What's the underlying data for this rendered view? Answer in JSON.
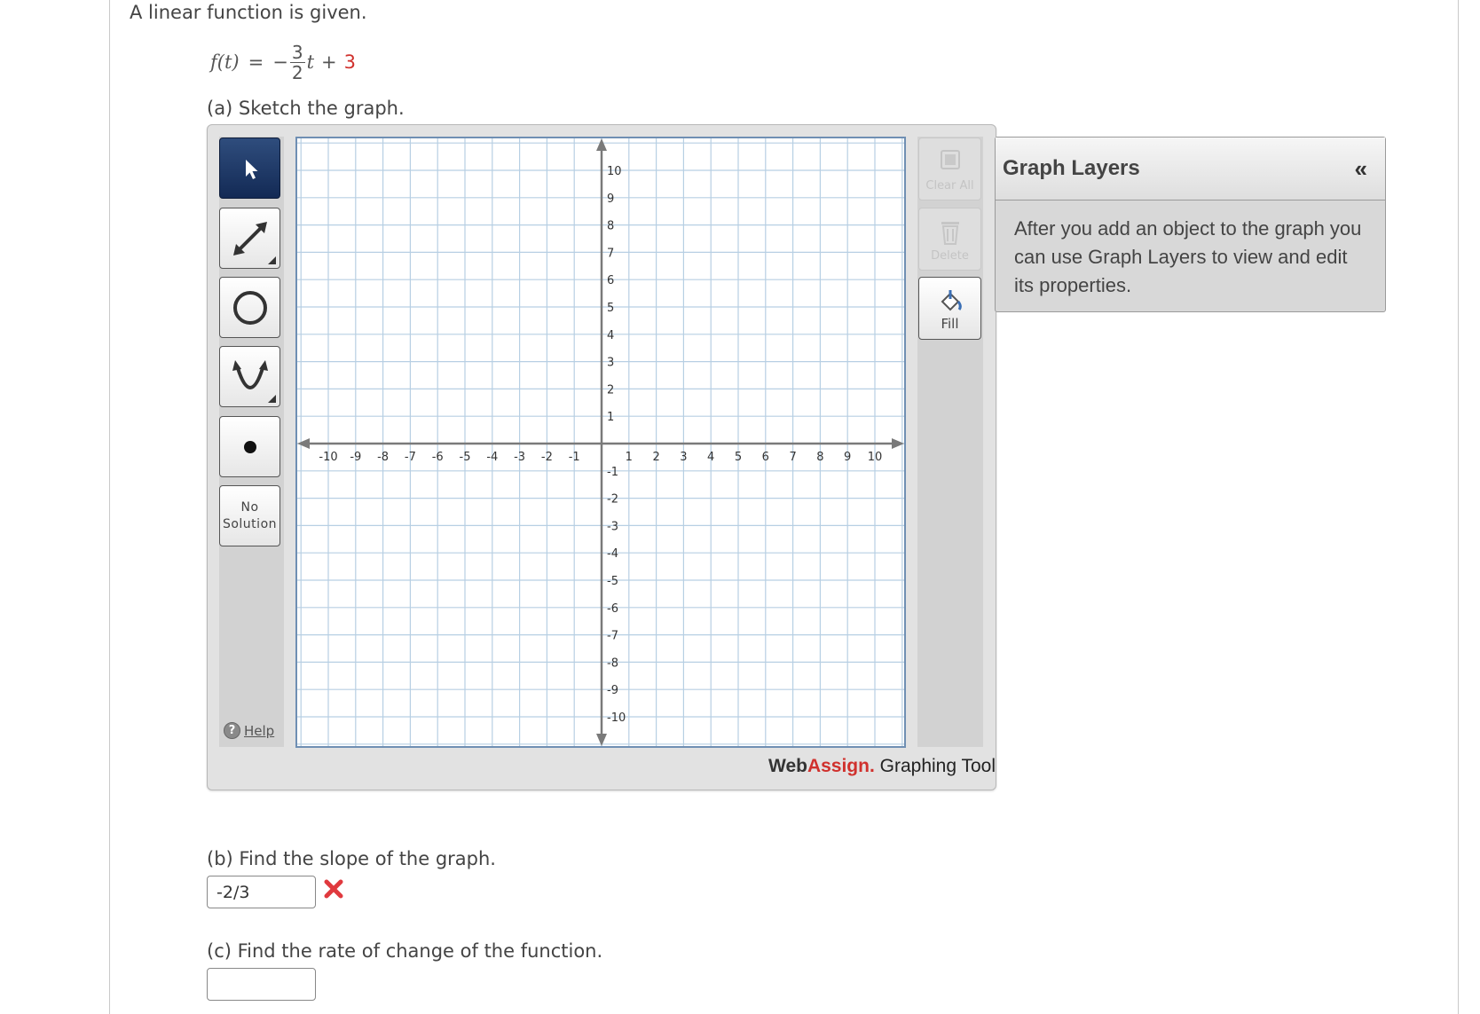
{
  "question": {
    "intro": "A linear function is given.",
    "formula": {
      "lhs": "f(t)",
      "equals": "=",
      "sign": "−",
      "numerator": "3",
      "denominator": "2",
      "variable": "t",
      "plus": "+",
      "constant": "3"
    }
  },
  "part_a": {
    "label": "(a) Sketch the graph."
  },
  "graphing_tool": {
    "tools": [
      {
        "name": "pointer",
        "icon": "pointer-arrow-icon",
        "active": true
      },
      {
        "name": "line",
        "icon": "line-tool-icon"
      },
      {
        "name": "circle",
        "icon": "circle-tool-icon"
      },
      {
        "name": "parabola",
        "icon": "parabola-tool-icon"
      },
      {
        "name": "point",
        "icon": "point-tool-icon"
      }
    ],
    "no_solution_line1": "No",
    "no_solution_line2": "Solution",
    "help_symbol": "?",
    "help_label": "Help",
    "clear_all_label": "Clear All",
    "delete_label": "Delete",
    "fill_label": "Fill",
    "brand_web": "Web",
    "brand_assign": "Assign.",
    "brand_suffix": " Graphing Tool",
    "grid": {
      "x_min": -10,
      "x_max": 10,
      "y_min": -10,
      "y_max": 10,
      "x_ticks": [
        "-10",
        "-9",
        "-8",
        "-7",
        "-6",
        "-5",
        "-4",
        "-3",
        "-2",
        "-1",
        "1",
        "2",
        "3",
        "4",
        "5",
        "6",
        "7",
        "8",
        "9",
        "10"
      ],
      "y_ticks": [
        "10",
        "9",
        "8",
        "7",
        "6",
        "5",
        "4",
        "3",
        "2",
        "1",
        "-1",
        "-2",
        "-3",
        "-4",
        "-5",
        "-6",
        "-7",
        "-8",
        "-9",
        "-10"
      ],
      "grid_color": "#b7cfe3",
      "axis_color": "#7a7a7a"
    },
    "layers_panel": {
      "title": "Graph Layers",
      "collapse_symbol": "«",
      "body": "After you add an object to the graph you can use Graph Layers to view and edit its properties."
    }
  },
  "part_b": {
    "label": "(b) Find the slope of the graph.",
    "answer": "-2/3",
    "status_icon": "incorrect-x-icon"
  },
  "part_c": {
    "label": "(c) Find the rate of change of the function.",
    "answer": ""
  }
}
